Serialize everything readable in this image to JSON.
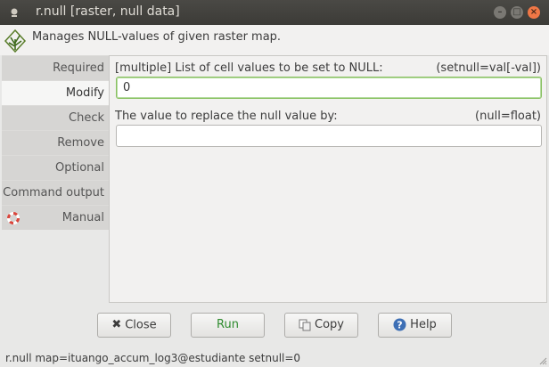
{
  "window": {
    "title": "r.null [raster, null data]"
  },
  "header": {
    "description": "Manages NULL-values of given raster map."
  },
  "sidebar": {
    "items": [
      {
        "label": "Required",
        "active": false
      },
      {
        "label": "Modify",
        "active": true
      },
      {
        "label": "Check",
        "active": false
      },
      {
        "label": "Remove",
        "active": false
      },
      {
        "label": "Optional",
        "active": false
      },
      {
        "label": "Command output",
        "active": false
      },
      {
        "label": "Manual",
        "active": false,
        "icon": "lifebuoy-icon"
      }
    ]
  },
  "main": {
    "setnull": {
      "label": "[multiple] List of cell values to be set to NULL:",
      "param": "(setnull=val[-val])",
      "value": "0"
    },
    "null": {
      "label": "The value to replace the null value by:",
      "param": "(null=float)",
      "value": ""
    }
  },
  "buttons": {
    "close": "Close",
    "run": "Run",
    "copy": "Copy",
    "help": "Help"
  },
  "status": {
    "command": "r.null map=ituango_accum_log3@estudiante setnull=0"
  },
  "colors": {
    "accent_green": "#88c060",
    "run_text": "#2e8b2e",
    "close_button": "#f07746"
  }
}
